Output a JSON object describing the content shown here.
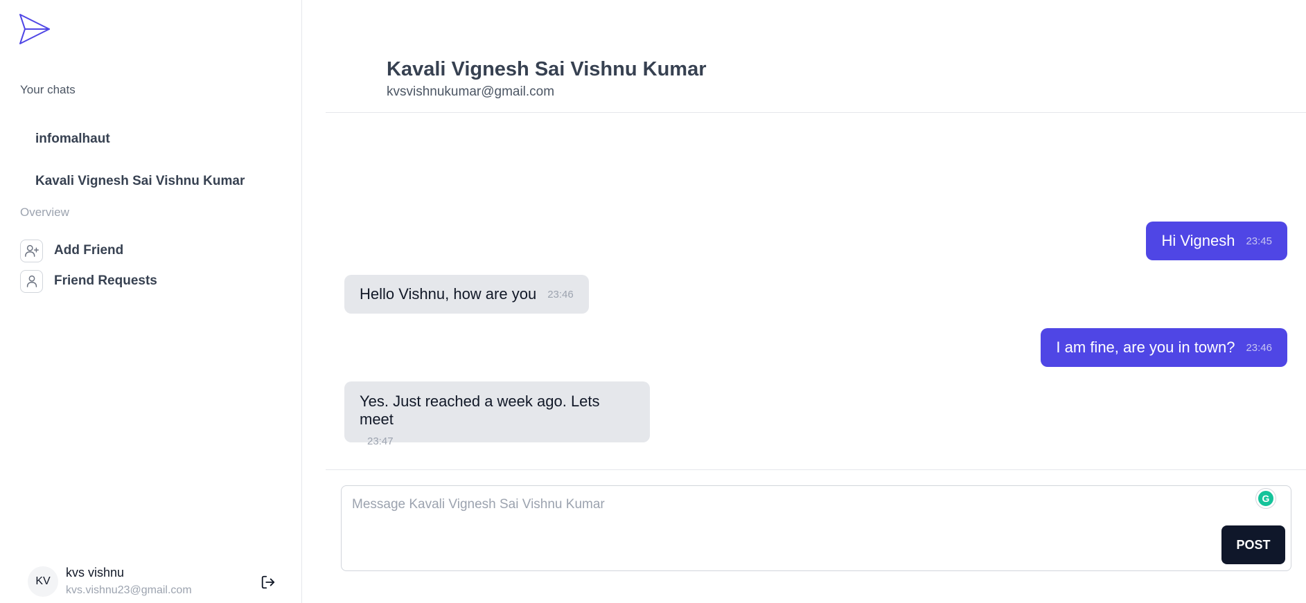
{
  "sidebar": {
    "logo_icon": "paper-plane-icon",
    "chats_heading": "Your chats",
    "chats": [
      {
        "label": "infomalhaut"
      },
      {
        "label": "Kavali Vignesh Sai Vishnu Kumar"
      }
    ],
    "overview_heading": "Overview",
    "nav": [
      {
        "label": "Add Friend",
        "icon": "user-plus-icon"
      },
      {
        "label": "Friend Requests",
        "icon": "user-icon"
      }
    ],
    "user": {
      "initials": "KV",
      "name": "kvs vishnu",
      "email": "kvs.vishnu23@gmail.com",
      "logout_icon": "logout-icon"
    }
  },
  "header": {
    "name": "Kavali Vignesh Sai Vishnu Kumar",
    "email": "kvsvishnukumar@gmail.com"
  },
  "messages": [
    {
      "sender": "me",
      "text": "Hi Vignesh",
      "time": "23:45"
    },
    {
      "sender": "them",
      "text": "Hello Vishnu, how are you",
      "time": "23:46"
    },
    {
      "sender": "me",
      "text": "I am fine, are you in town?",
      "time": "23:46"
    },
    {
      "sender": "them",
      "text": "Yes. Just reached a week ago. Lets meet",
      "time": "23:47"
    }
  ],
  "composer": {
    "placeholder": "Message Kavali Vignesh Sai Vishnu Kumar",
    "value": "",
    "post_label": "POST",
    "grammarly_icon": "grammarly-icon"
  },
  "colors": {
    "accent": "#4f46e5",
    "incoming_bubble": "#e5e7eb",
    "post_button": "#0f172a"
  }
}
